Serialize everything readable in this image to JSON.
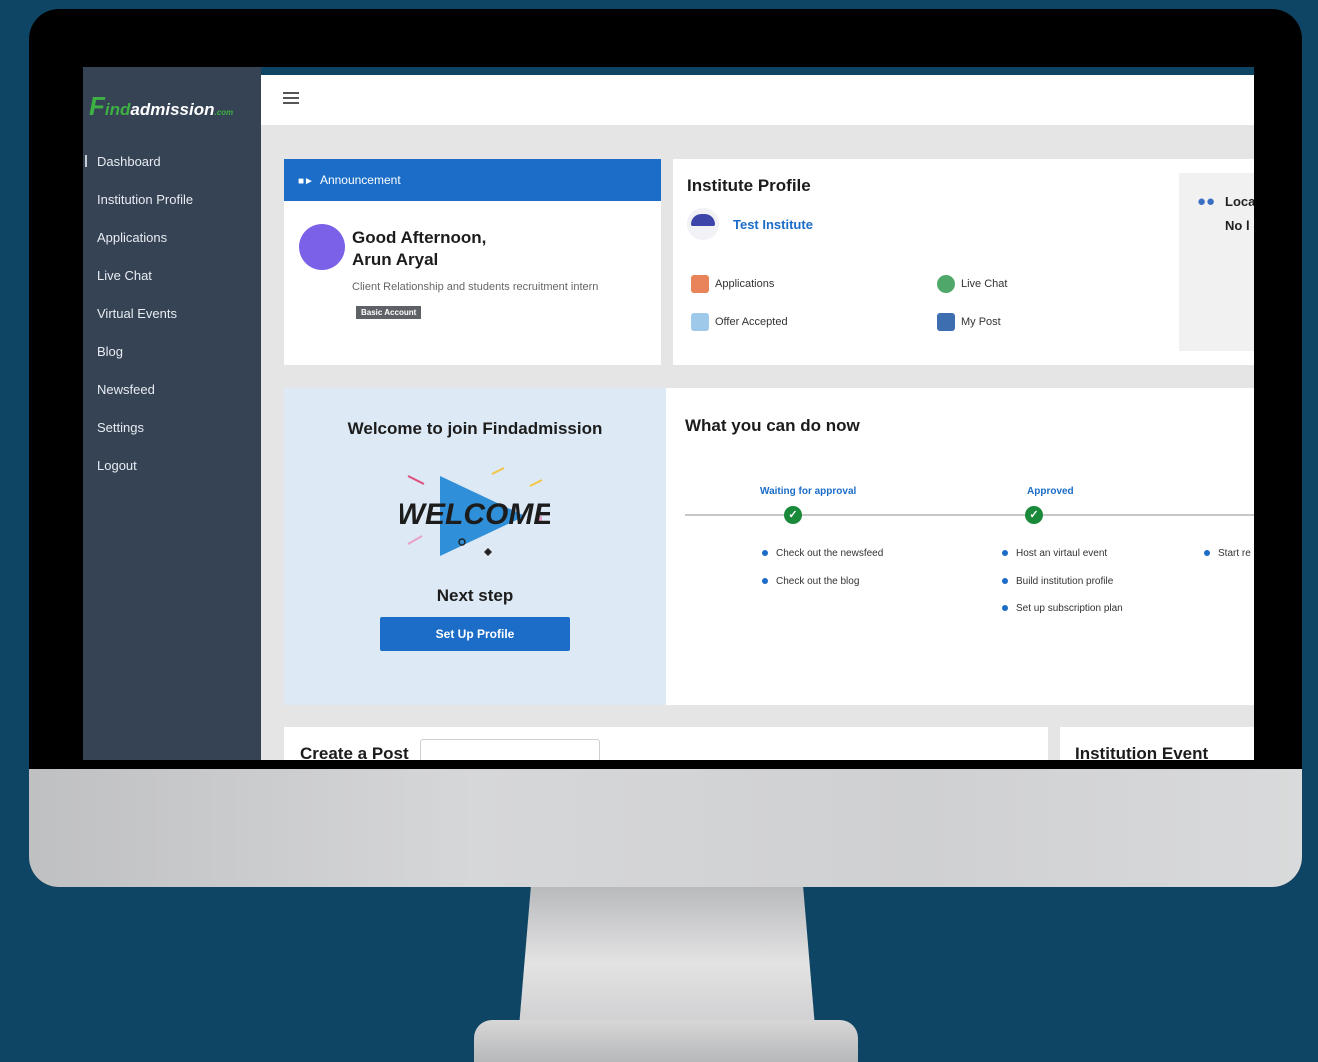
{
  "app": {
    "logo_f": "F",
    "logo_ind": "ind",
    "logo_rest": "admission",
    "logo_com": ".com"
  },
  "sidebar": {
    "items": [
      {
        "label": "Dashboard"
      },
      {
        "label": "Institution Profile"
      },
      {
        "label": "Applications"
      },
      {
        "label": "Live Chat"
      },
      {
        "label": "Virtual Events"
      },
      {
        "label": "Blog"
      },
      {
        "label": "Newsfeed"
      },
      {
        "label": "Settings"
      },
      {
        "label": "Logout"
      }
    ]
  },
  "announcement": {
    "header": "Announcement",
    "greeting_line1": "Good Afternoon,",
    "greeting_line2": "Arun Aryal",
    "role": "Client Relationship and students recruitment intern",
    "badge": "Basic Account"
  },
  "institute_profile": {
    "title": "Institute Profile",
    "name": "Test Institute",
    "stats": [
      {
        "label": "Applications",
        "icon": "applications-icon"
      },
      {
        "label": "Live Chat",
        "icon": "live-chat-icon"
      },
      {
        "label": "Offer Accepted",
        "icon": "offer-accepted-icon"
      },
      {
        "label": "My Post",
        "icon": "my-post-icon"
      }
    ],
    "location_title": "Loca",
    "location_value": "No l"
  },
  "welcome": {
    "title": "Welcome to join Findadmission",
    "art_text": "WELCOME",
    "next_step": "Next step",
    "setup_button": "Set Up Profile"
  },
  "what_now": {
    "title": "What you can do now",
    "steps": [
      {
        "label": "Waiting for approval",
        "items": [
          "Check out the newsfeed",
          "Check out the blog"
        ]
      },
      {
        "label": "Approved",
        "items": [
          "Host an virtaul event",
          "Build institution profile",
          "Set up subscription plan"
        ]
      },
      {
        "label": "",
        "items": [
          "Start re"
        ]
      }
    ]
  },
  "bottom": {
    "create_post": "Create a Post",
    "institution_event": "Institution Event"
  },
  "colors": {
    "background": "#0f4564",
    "sidebar": "#364354",
    "accent": "#1b6dc8",
    "success": "#1a8a3a",
    "avatar": "#7b61e8",
    "welcome_panel": "#dde9f4"
  }
}
